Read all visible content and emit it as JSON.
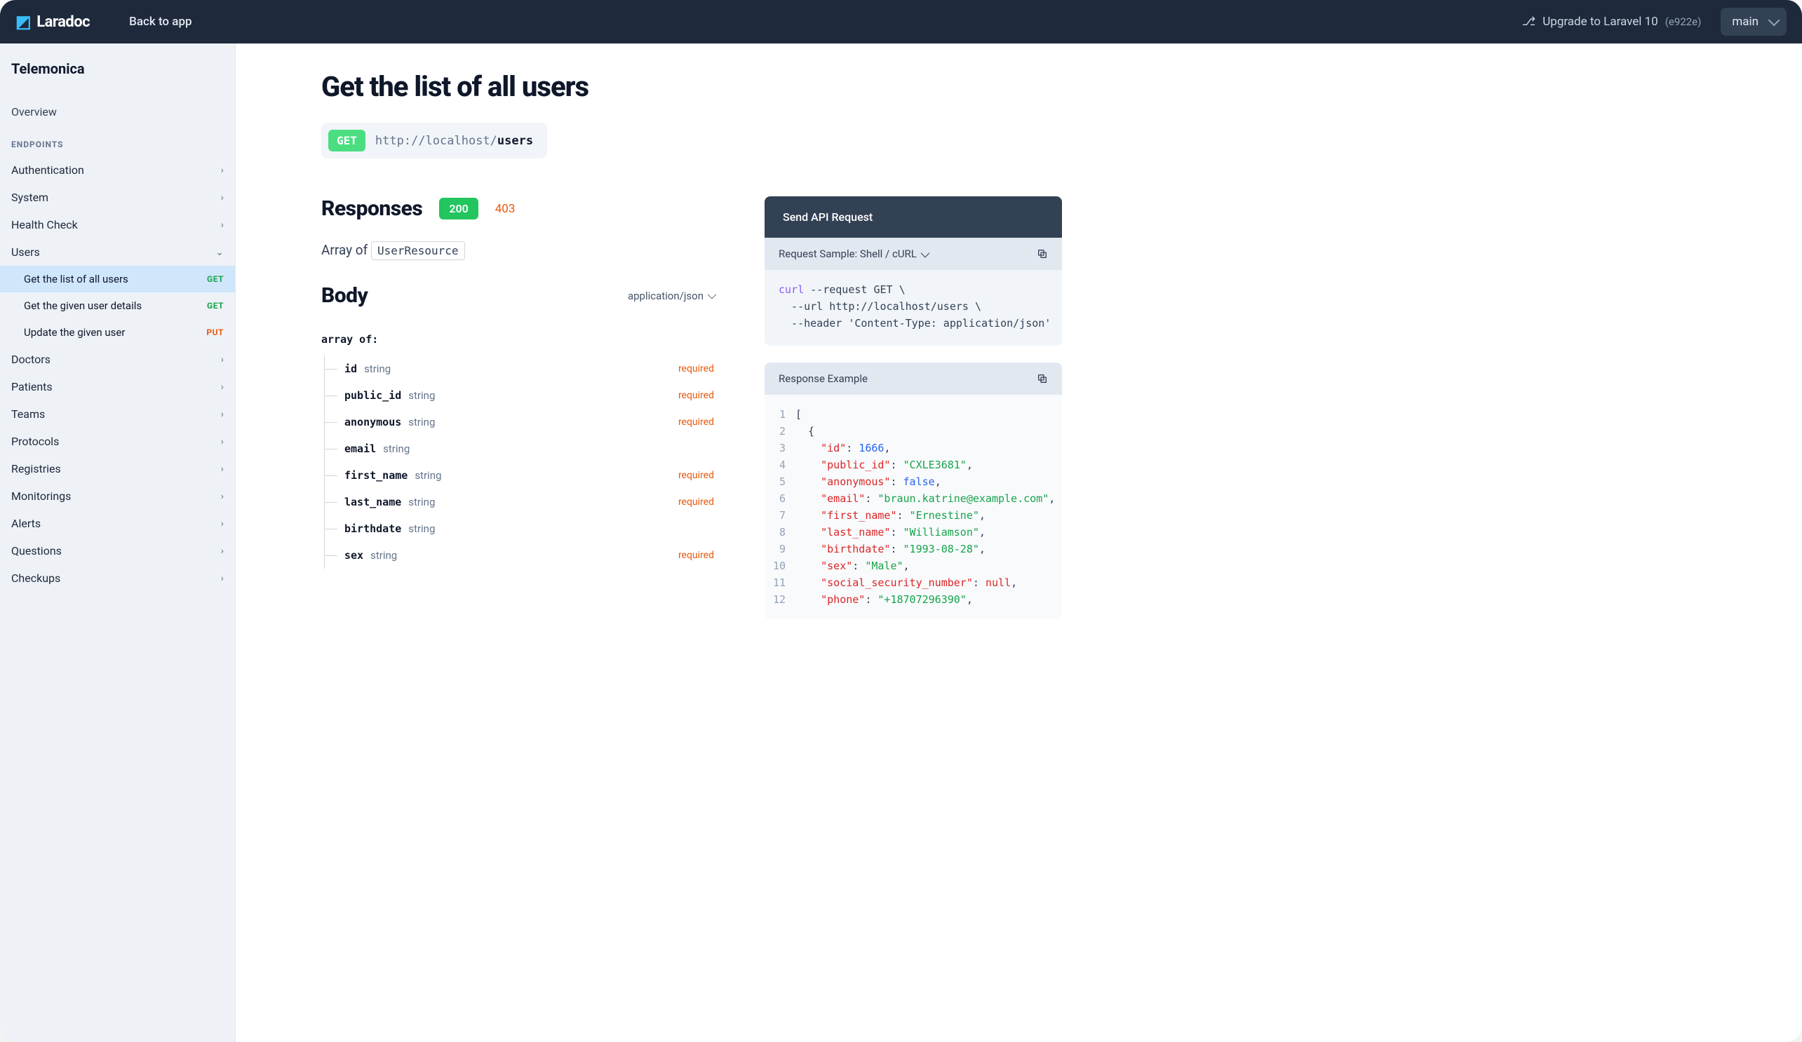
{
  "header": {
    "brand": "Laradoc",
    "back": "Back to app",
    "upgrade": "Upgrade to Laravel 10",
    "upgrade_hash": "(e922e)",
    "branch": "main"
  },
  "sidebar": {
    "project": "Telemonica",
    "overview": "Overview",
    "section_label": "ENDPOINTS",
    "groups": [
      {
        "label": "Authentication",
        "expanded": false
      },
      {
        "label": "System",
        "expanded": false
      },
      {
        "label": "Health Check",
        "expanded": false
      },
      {
        "label": "Users",
        "expanded": true,
        "items": [
          {
            "label": "Get the list of all users",
            "method": "GET",
            "active": true
          },
          {
            "label": "Get the given user details",
            "method": "GET",
            "active": false
          },
          {
            "label": "Update the given user",
            "method": "PUT",
            "active": false
          }
        ]
      },
      {
        "label": "Doctors",
        "expanded": false
      },
      {
        "label": "Patients",
        "expanded": false
      },
      {
        "label": "Teams",
        "expanded": false
      },
      {
        "label": "Protocols",
        "expanded": false
      },
      {
        "label": "Registries",
        "expanded": false
      },
      {
        "label": "Monitorings",
        "expanded": false
      },
      {
        "label": "Alerts",
        "expanded": false
      },
      {
        "label": "Questions",
        "expanded": false
      },
      {
        "label": "Checkups",
        "expanded": false
      }
    ]
  },
  "page": {
    "title": "Get the list of all users",
    "method": "GET",
    "url_prefix": "http://localhost/",
    "url_path": "users",
    "responses_heading": "Responses",
    "status_ok": "200",
    "status_alt": "403",
    "array_of_label": "Array of",
    "resource": "UserResource",
    "body_heading": "Body",
    "content_type": "application/json",
    "schema_label": "array of:",
    "fields": [
      {
        "name": "id",
        "type": "string",
        "required": true
      },
      {
        "name": "public_id",
        "type": "string",
        "required": true
      },
      {
        "name": "anonymous",
        "type": "string",
        "required": true
      },
      {
        "name": "email",
        "type": "string",
        "required": false
      },
      {
        "name": "first_name",
        "type": "string",
        "required": true
      },
      {
        "name": "last_name",
        "type": "string",
        "required": true
      },
      {
        "name": "birthdate",
        "type": "string",
        "required": false
      },
      {
        "name": "sex",
        "type": "string",
        "required": true
      }
    ]
  },
  "right": {
    "send_label": "Send API Request",
    "sample_label": "Request Sample: Shell / cURL",
    "curl": {
      "cmd": "curl",
      "l1": " --request GET \\",
      "l2": "  --url http://localhost/users \\",
      "l3": "  --header 'Content-Type: application/json'"
    },
    "response_label": "Response Example",
    "json_lines": [
      {
        "n": 1,
        "raw": "["
      },
      {
        "n": 2,
        "raw": "  {"
      },
      {
        "n": 3,
        "key": "id",
        "kind": "num",
        "val": "1666",
        "comma": true,
        "indent": "    "
      },
      {
        "n": 4,
        "key": "public_id",
        "kind": "str",
        "val": "CXLE3681",
        "comma": true,
        "indent": "    "
      },
      {
        "n": 5,
        "key": "anonymous",
        "kind": "bool",
        "val": "false",
        "comma": true,
        "indent": "    "
      },
      {
        "n": 6,
        "key": "email",
        "kind": "str",
        "val": "braun.katrine@example.com",
        "comma": true,
        "indent": "    "
      },
      {
        "n": 7,
        "key": "first_name",
        "kind": "str",
        "val": "Ernestine",
        "comma": true,
        "indent": "    "
      },
      {
        "n": 8,
        "key": "last_name",
        "kind": "str",
        "val": "Williamson",
        "comma": true,
        "indent": "    "
      },
      {
        "n": 9,
        "key": "birthdate",
        "kind": "str",
        "val": "1993-08-28",
        "comma": true,
        "indent": "    "
      },
      {
        "n": 10,
        "key": "sex",
        "kind": "str",
        "val": "Male",
        "comma": true,
        "indent": "    "
      },
      {
        "n": 11,
        "key": "social_security_number",
        "kind": "null",
        "val": "null",
        "comma": true,
        "indent": "    "
      },
      {
        "n": 12,
        "key": "phone",
        "kind": "str",
        "val": "+18707296390",
        "comma": true,
        "indent": "    "
      }
    ]
  }
}
